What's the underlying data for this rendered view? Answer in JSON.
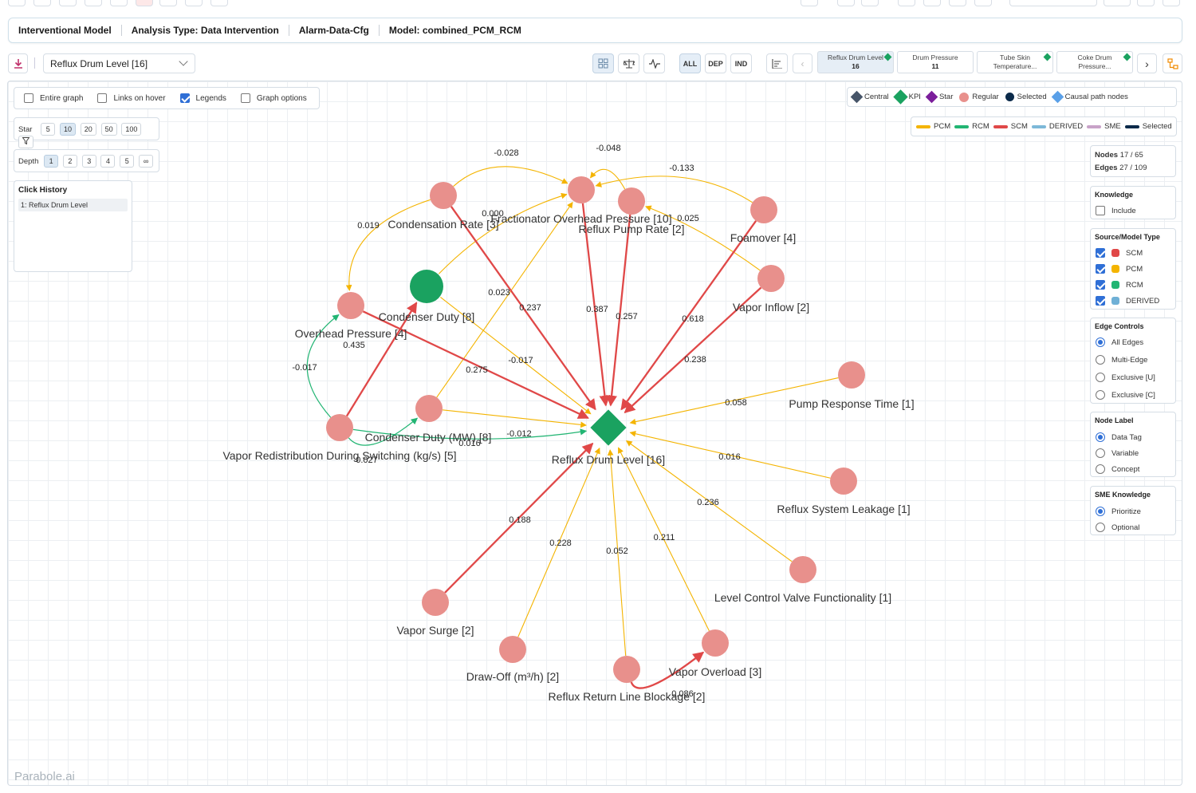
{
  "header": {
    "items": [
      "Interventional Model",
      "Analysis Type: Data Intervention",
      "Alarm-Data-Cfg",
      "Model: combined_PCM_RCM"
    ]
  },
  "toolbar": {
    "target_select": "Reflux Drum Level [16]",
    "scope_buttons": [
      "ALL",
      "DEP",
      "IND"
    ],
    "targets": [
      {
        "label": "Reflux Drum Level",
        "value": "16",
        "kpi": true,
        "active": true
      },
      {
        "label": "Drum Pressure",
        "value": "11",
        "kpi": false,
        "active": false
      },
      {
        "label": "Tube Skin Temperature...",
        "value": "",
        "kpi": true,
        "active": false
      },
      {
        "label": "Coke Drum Pressure...",
        "value": "",
        "kpi": true,
        "active": false
      }
    ]
  },
  "options": {
    "items": [
      {
        "label": "Entire graph",
        "checked": false
      },
      {
        "label": "Links on hover",
        "checked": false
      },
      {
        "label": "Legends",
        "checked": true
      },
      {
        "label": "Graph options",
        "checked": false
      }
    ]
  },
  "star": {
    "label": "Star",
    "values": [
      "5",
      "10",
      "20",
      "50",
      "100"
    ],
    "selected": "10"
  },
  "depth": {
    "label": "Depth",
    "values": [
      "1",
      "2",
      "3",
      "4",
      "5",
      "∞"
    ],
    "selected": "1"
  },
  "history": {
    "title": "Click History",
    "items": [
      "1: Reflux Drum Level"
    ]
  },
  "node_legend": [
    {
      "label": "Central",
      "shape": "diamond",
      "color": "#475569"
    },
    {
      "label": "KPI",
      "shape": "diamond",
      "color": "#1aa260"
    },
    {
      "label": "Star",
      "shape": "diamond",
      "color": "#7b1e9b"
    },
    {
      "label": "Regular",
      "shape": "circle",
      "color": "#e8908c"
    },
    {
      "label": "Selected",
      "shape": "circle",
      "color": "#0b2a4a"
    },
    {
      "label": "Causal path nodes",
      "shape": "diamond",
      "color": "#5aa0e8"
    }
  ],
  "edge_legend": [
    {
      "label": "PCM",
      "color": "#f4b400"
    },
    {
      "label": "RCM",
      "color": "#22b573"
    },
    {
      "label": "SCM",
      "color": "#e04848"
    },
    {
      "label": "DERIVED",
      "color": "#7db8d8"
    },
    {
      "label": "SME",
      "color": "#c8a2c8"
    },
    {
      "label": "Selected",
      "color": "#0b2a4a"
    }
  ],
  "stats": {
    "nodes_label": "Nodes",
    "nodes_value": "17 / 65",
    "edges_label": "Edges",
    "edges_value": "27 / 109"
  },
  "knowledge": {
    "title": "Knowledge",
    "option": "Include",
    "checked": false
  },
  "source_type": {
    "title": "Source/Model Type",
    "items": [
      {
        "label": "SCM",
        "color": "#e04848"
      },
      {
        "label": "PCM",
        "color": "#f4b400"
      },
      {
        "label": "RCM",
        "color": "#22b573"
      },
      {
        "label": "DERIVED",
        "color": "#6fb0d6"
      }
    ]
  },
  "edge_controls": {
    "title": "Edge Controls",
    "options": [
      "All Edges",
      "Multi-Edge",
      "Exclusive [U]",
      "Exclusive [C]"
    ],
    "selected": 0
  },
  "node_label": {
    "title": "Node Label",
    "options": [
      "Data Tag",
      "Variable",
      "Concept"
    ],
    "selected": 0
  },
  "sme": {
    "title": "SME Knowledge",
    "options": [
      "Prioritize",
      "Optional"
    ],
    "selected": 0
  },
  "watermark": "Parabole.ai",
  "graph": {
    "nodes": [
      {
        "id": "rdl",
        "label": "Reflux Drum Level [16]",
        "kind": "kpi"
      },
      {
        "id": "fop",
        "label": "Fractionator Overhead Pressure [10]",
        "kind": "regular"
      },
      {
        "id": "rpr",
        "label": "Reflux Pump Rate [2]",
        "kind": "regular"
      },
      {
        "id": "cr",
        "label": "Condensation Rate [3]",
        "kind": "regular"
      },
      {
        "id": "fo",
        "label": "Foamover [4]",
        "kind": "regular"
      },
      {
        "id": "cd",
        "label": "Condenser Duty [8]",
        "kind": "kpi-circle"
      },
      {
        "id": "op",
        "label": "Overhead Pressure [4]",
        "kind": "regular"
      },
      {
        "id": "vi",
        "label": "Vapor Inflow [2]",
        "kind": "regular"
      },
      {
        "id": "cdmw",
        "label": "Condenser Duty (MW) [8]",
        "kind": "regular"
      },
      {
        "id": "vrd",
        "label": "Vapor Redistribution During Switching (kg/s) [5]",
        "kind": "regular"
      },
      {
        "id": "prt",
        "label": "Pump Response Time [1]",
        "kind": "regular"
      },
      {
        "id": "rsl",
        "label": "Reflux System Leakage [1]",
        "kind": "regular"
      },
      {
        "id": "lcv",
        "label": "Level Control Valve Functionality [1]",
        "kind": "regular"
      },
      {
        "id": "vs",
        "label": "Vapor Surge [2]",
        "kind": "regular"
      },
      {
        "id": "do",
        "label": "Draw-Off (m³/h) [2]",
        "kind": "regular"
      },
      {
        "id": "rrl",
        "label": "Reflux Return Line Blockage [2]",
        "kind": "regular"
      },
      {
        "id": "vo",
        "label": "Vapor Overload [3]",
        "kind": "regular"
      }
    ],
    "edges": [
      {
        "from": "cr",
        "to": "fop",
        "label": "-0.028",
        "type": "PCM"
      },
      {
        "from": "rpr",
        "to": "fop",
        "label": "-0.048",
        "type": "PCM"
      },
      {
        "from": "fo",
        "to": "fop",
        "label": "-0.133",
        "type": "PCM"
      },
      {
        "from": "cr",
        "to": "op",
        "label": "0.019",
        "type": "PCM"
      },
      {
        "from": "cd",
        "to": "fop",
        "label": "0.000",
        "type": "PCM"
      },
      {
        "from": "vi",
        "to": "rpr",
        "label": "0.025",
        "type": "PCM"
      },
      {
        "from": "cdmw",
        "to": "fop",
        "label": "0.023",
        "type": "PCM"
      },
      {
        "from": "cr",
        "to": "rdl",
        "label": "0.237",
        "type": "SCM"
      },
      {
        "from": "fop",
        "to": "rdl",
        "label": "0.387",
        "type": "SCM"
      },
      {
        "from": "rpr",
        "to": "rdl",
        "label": "0.257",
        "type": "SCM"
      },
      {
        "from": "fo",
        "to": "rdl",
        "label": "0.618",
        "type": "SCM"
      },
      {
        "from": "vi",
        "to": "rdl",
        "label": "0.238",
        "type": "SCM"
      },
      {
        "from": "op",
        "to": "rdl",
        "label": "0.275",
        "type": "SCM"
      },
      {
        "from": "cd",
        "to": "rdl",
        "label": "-0.017",
        "type": "PCM"
      },
      {
        "from": "vrd",
        "to": "cd",
        "label": "0.435",
        "type": "SCM"
      },
      {
        "from": "vrd",
        "to": "op",
        "label": "-0.017",
        "type": "RCM"
      },
      {
        "from": "vrd",
        "to": "cdmw",
        "label": "0.027",
        "type": "RCM"
      },
      {
        "from": "vrd",
        "to": "rdl",
        "label": "0.016",
        "type": "RCM"
      },
      {
        "from": "cdmw",
        "to": "rdl",
        "label": "-0.012",
        "type": "PCM"
      },
      {
        "from": "prt",
        "to": "rdl",
        "label": "0.058",
        "type": "PCM"
      },
      {
        "from": "rsl",
        "to": "rdl",
        "label": "0.016",
        "type": "PCM"
      },
      {
        "from": "lcv",
        "to": "rdl",
        "label": "0.236",
        "type": "PCM"
      },
      {
        "from": "vs",
        "to": "rdl",
        "label": "0.188",
        "type": "SCM"
      },
      {
        "from": "do",
        "to": "rdl",
        "label": "0.228",
        "type": "PCM"
      },
      {
        "from": "rrl",
        "to": "rdl",
        "label": "0.052",
        "type": "PCM"
      },
      {
        "from": "vo",
        "to": "rdl",
        "label": "0.211",
        "type": "PCM"
      },
      {
        "from": "rrl",
        "to": "vo",
        "label": "0.086",
        "type": "SCM"
      }
    ]
  }
}
